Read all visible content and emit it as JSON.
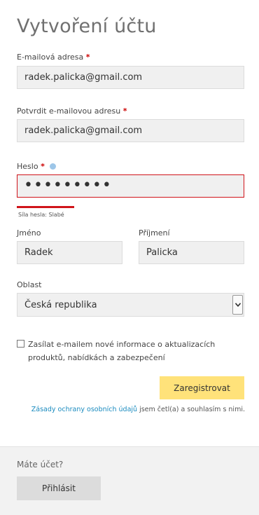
{
  "title": "Vytvoření účtu",
  "email": {
    "label": "E-mailová adresa",
    "required": "*",
    "value": "radek.palicka@gmail.com"
  },
  "confirm_email": {
    "label": "Potvrdit e-mailovou adresu",
    "required": "*",
    "value": "radek.palicka@gmail.com"
  },
  "password": {
    "label": "Heslo",
    "required": "*",
    "masked_value": "•••••••••",
    "info_icon": "info-icon",
    "strength_text": "Síla hesla: Slabé",
    "strength_color": "#d0141a"
  },
  "first_name": {
    "label": "Jméno",
    "value": "Radek"
  },
  "last_name": {
    "label": "Příjmení",
    "value": "Palicka"
  },
  "region": {
    "label": "Oblast",
    "value": "Česká republika",
    "arrow_icon": "chevron-down-icon"
  },
  "newsletter": {
    "label": "Zasílat e-mailem nové informace o aktualizacích produktů, nabídkách a zabezpečení",
    "checked": false
  },
  "register_button": "Zaregistrovat",
  "privacy": {
    "link": "Zásady ochrany osobních údajů",
    "text": " jsem četl(a) a souhlasím s nimi."
  },
  "footer": {
    "question": "Máte účet?",
    "login_button": "Přihlásit"
  },
  "colors": {
    "accent_button": "#ffe27a",
    "link": "#1a8bbf",
    "error": "#d0141a",
    "input_bg": "#f0f0f0"
  }
}
